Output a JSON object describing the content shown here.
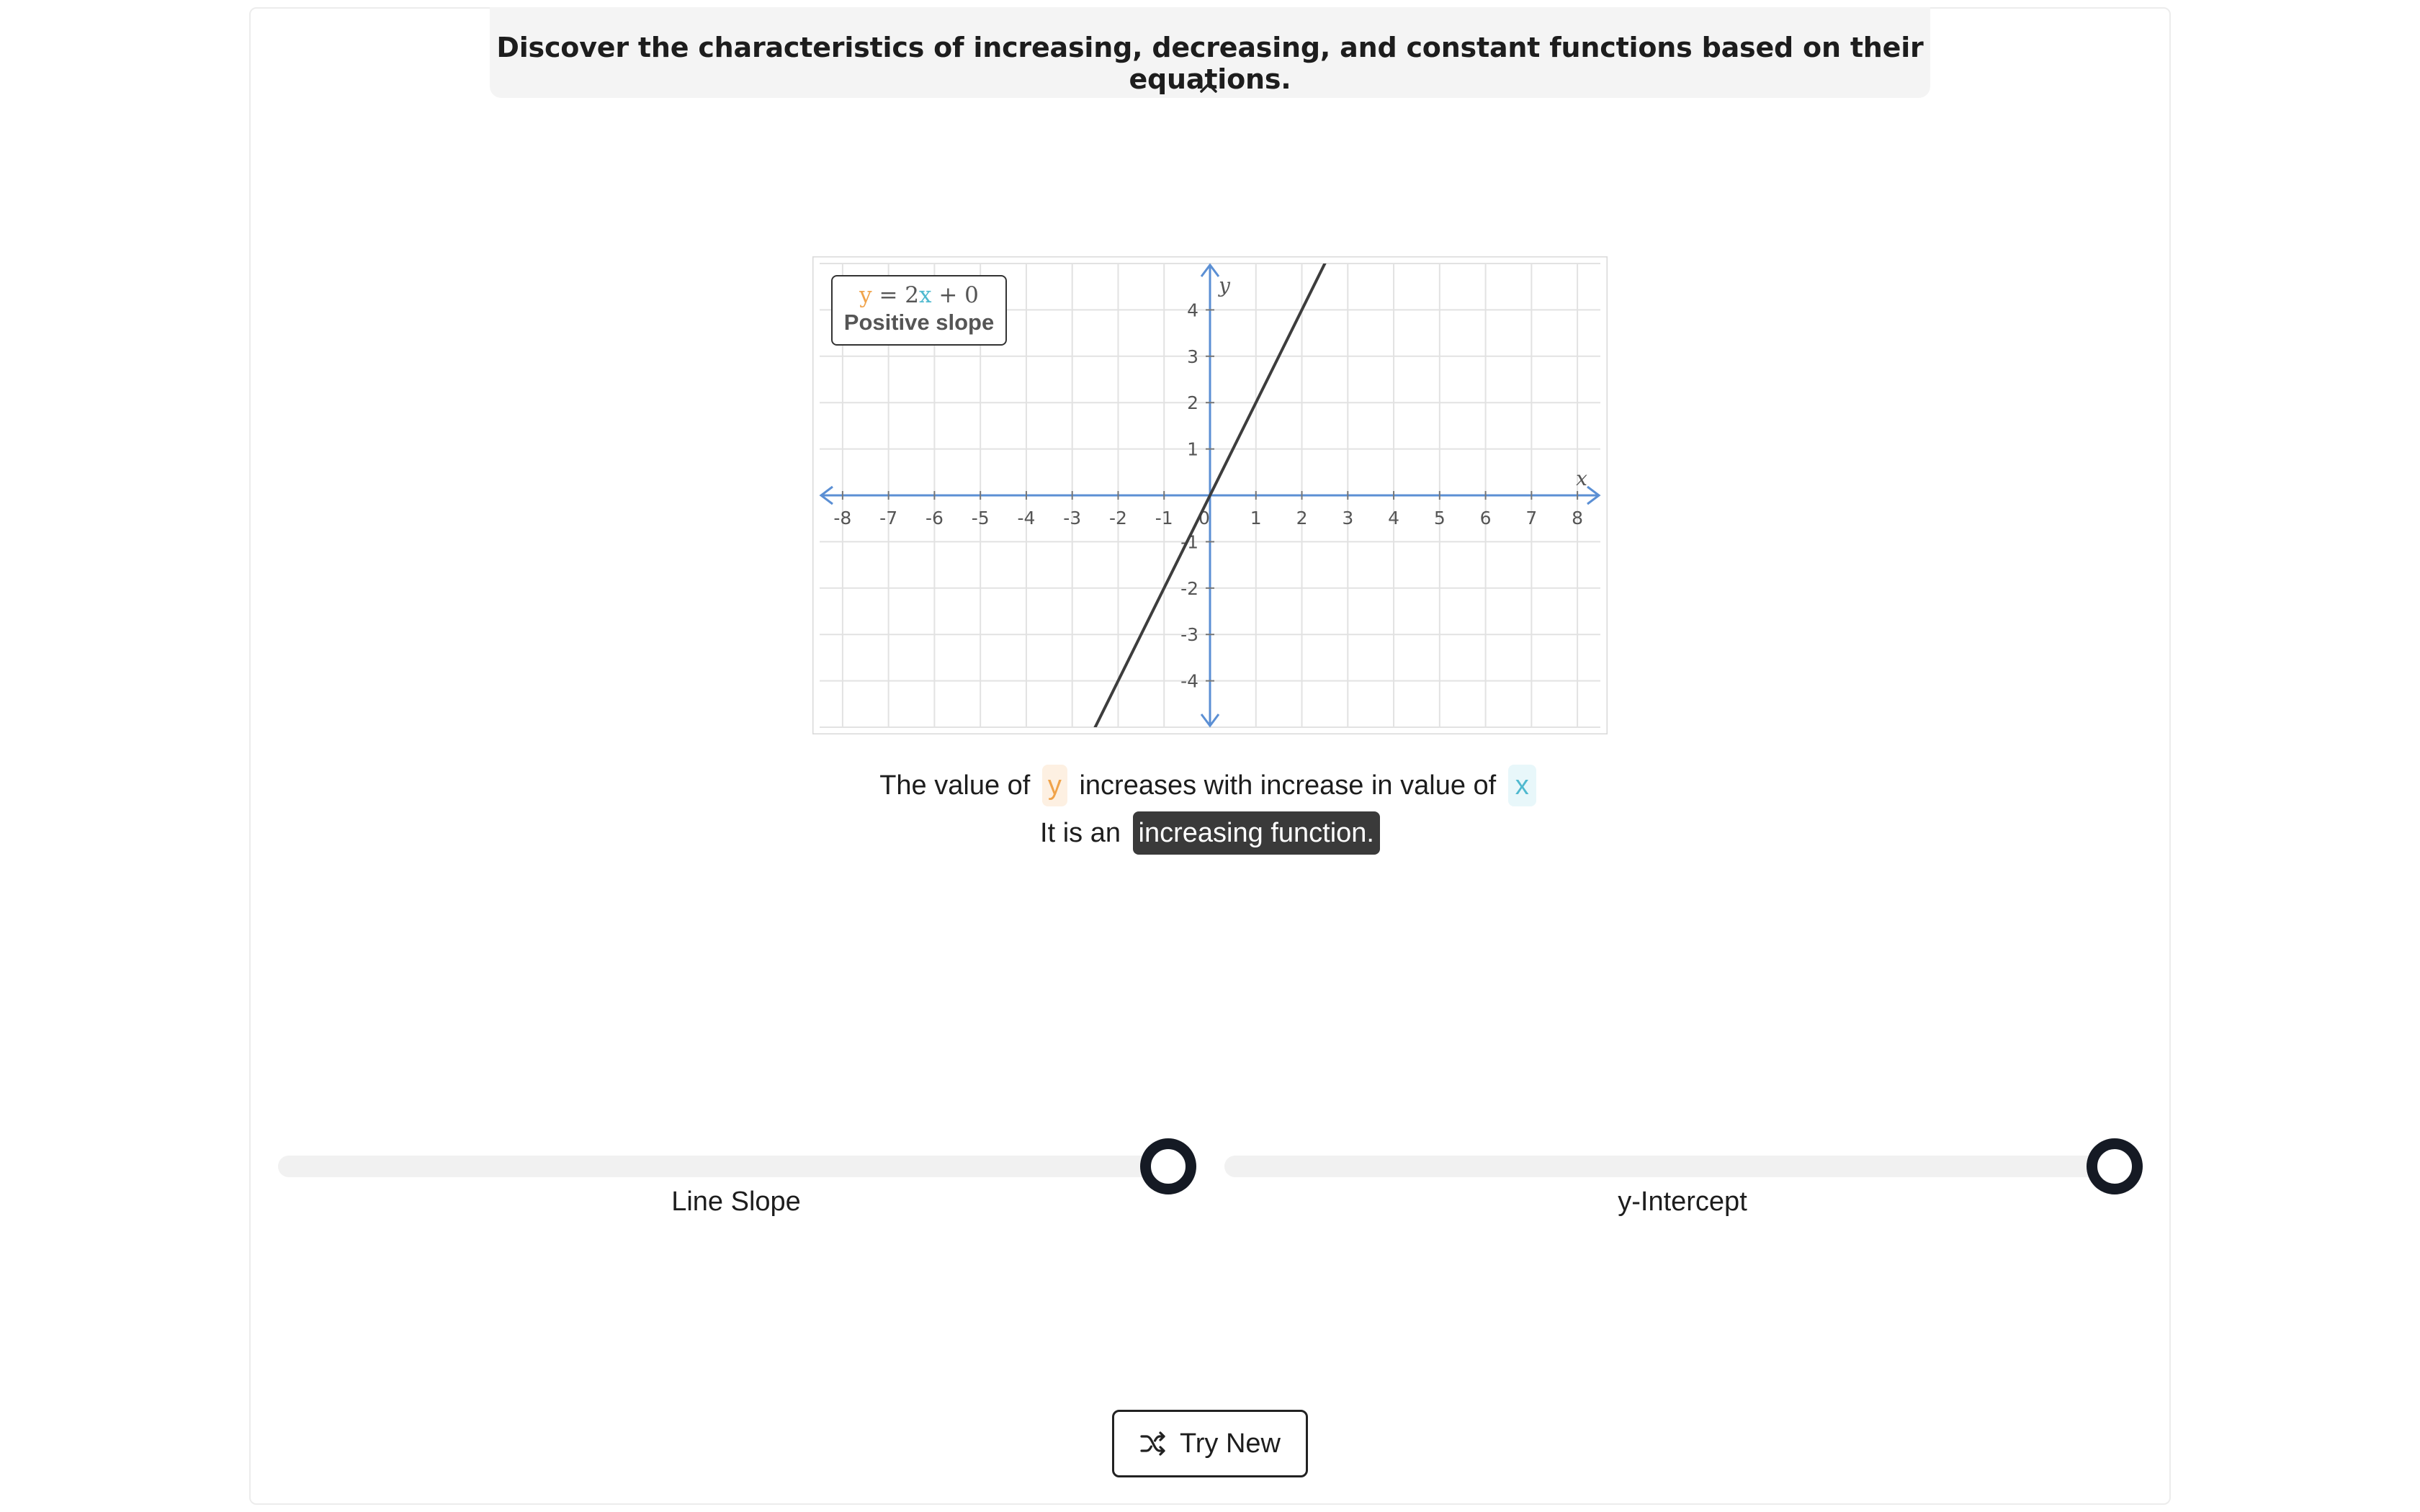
{
  "banner": {
    "text": "Discover the characteristics of increasing, decreasing, and constant functions based on their equations."
  },
  "equation": {
    "y": "y",
    "eq": " = 2",
    "x": "x",
    "rest": " + 0",
    "subtitle": "Positive slope"
  },
  "statement": {
    "part1": "The value of",
    "y": "y",
    "part2": "increases with increase in value of",
    "x": "x",
    "part3": "It is an",
    "highlight": "increasing function."
  },
  "sliders": {
    "slope": {
      "label": "Line Slope",
      "fraction": 1.0
    },
    "intercept": {
      "label": "y-Intercept",
      "fraction": 1.0
    }
  },
  "button": {
    "label": "Try New",
    "icon": "shuffle-icon"
  },
  "chart_data": {
    "type": "line",
    "series": [
      {
        "slope": 2,
        "intercept": 0,
        "color": "#3d3d3d"
      }
    ],
    "xlim": [
      -8.5,
      8.5
    ],
    "ylim": [
      -5,
      5
    ],
    "xticks": [
      "-8",
      "-7",
      "-6",
      "-5",
      "-4",
      "-3",
      "-2",
      "-1",
      "1",
      "2",
      "3",
      "4",
      "5",
      "6",
      "7",
      "8"
    ],
    "yticks": [
      "4",
      "3",
      "2",
      "1",
      "-1",
      "-2",
      "-3",
      "-4"
    ],
    "origin_label": "0",
    "xlabel": "x",
    "ylabel": "y",
    "grid": true,
    "axis_color": "#5b8fd4"
  },
  "colors": {
    "y_accent": "#f0a34a",
    "x_accent": "#4fb9cf",
    "thumb": "#151a24"
  }
}
